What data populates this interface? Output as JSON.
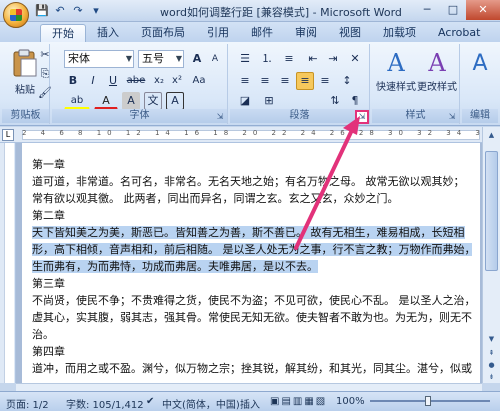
{
  "window": {
    "title": "word如何调整行距 [兼容模式] - Microsoft Word"
  },
  "qat_icons": [
    "save-icon",
    "undo-icon",
    "redo-icon",
    "customize-icon"
  ],
  "tabs": [
    "开始",
    "插入",
    "页面布局",
    "引用",
    "邮件",
    "审阅",
    "视图",
    "加载项",
    "Acrobat"
  ],
  "active_tab": "开始",
  "ribbon": {
    "clipboard": {
      "label": "剪贴板",
      "paste_label": "粘贴"
    },
    "font": {
      "label": "字体",
      "font_name": "宋体",
      "font_size": "五号",
      "bold": "B",
      "italic": "I",
      "underline": "U",
      "strike": "abe",
      "subscript": "x₂",
      "superscript": "x²",
      "change_case": "Aa",
      "grow": "A",
      "shrink": "A",
      "clear_fmt": "A",
      "highlight": "ab",
      "font_color": "A",
      "char_shade": "A",
      "wen": "文",
      "char_border": "A"
    },
    "paragraph": {
      "label": "段落"
    },
    "styles": {
      "label": "样式",
      "quick_styles": "快速样式",
      "change_styles": "更改样式",
      "big_a": "A"
    },
    "editing": {
      "label": "编辑",
      "big_a": "A"
    }
  },
  "ruler": {
    "numbers": "2 4 6 8 10 12 14 16 18 20 22 24 26 28 30 32 34 36 38"
  },
  "document": {
    "paragraphs": [
      {
        "text": "第一章",
        "selected": false
      },
      {
        "text": "道可道，非常道。名可名，非常名。无名天地之始；有名万物之母。 故常无欲以观其妙；",
        "selected": false
      },
      {
        "text": "常有欲以观其徼。 此两者，同出而异名，同谓之玄。玄之又玄，众妙之门。",
        "selected": false
      },
      {
        "text": "第二章",
        "selected": false
      },
      {
        "text": "天下皆知美之为美，斯恶已。皆知善之为善，斯不善已。 故有无相生，难易相成，长短相",
        "selected": true
      },
      {
        "text": "形，高下相倾，音声相和，前后相随。 是以圣人处无为之事，行不言之教；万物作而弗始，",
        "selected": true
      },
      {
        "text": "生而弗有，为而弗恃，功成而弗居。夫唯弗居，是以不去。",
        "selected": true
      },
      {
        "text": "第三章",
        "selected": false
      },
      {
        "text": "不尚贤，使民不争；不贵难得之货，使民不为盗；不见可欲，使民心不乱。 是以圣人之治，",
        "selected": false
      },
      {
        "text": "虚其心，实其腹，弱其志，强其骨。常使民无知无欲。使夫智者不敢为也。为无为，则无不",
        "selected": false
      },
      {
        "text": "治。",
        "selected": false
      },
      {
        "text": "第四章",
        "selected": false
      },
      {
        "text": "道冲，而用之或不盈。渊兮，似万物之宗；挫其锐，解其纷，和其光，同其尘。湛兮，似或",
        "selected": false
      }
    ]
  },
  "status": {
    "page": "页面: 1/2",
    "words": "字数: 105/1,412",
    "language": "中文(简体，中国)",
    "mode": "插入",
    "zoom": "100%"
  },
  "colors": {
    "highlight_annotation": "#e2327a",
    "selection": "#b9d3f1"
  }
}
